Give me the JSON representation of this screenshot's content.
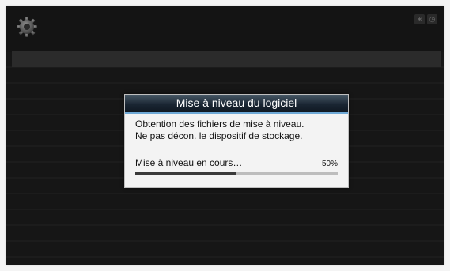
{
  "dialog": {
    "title": "Mise à niveau du logiciel",
    "message_line1": "Obtention des fichiers de mise à niveau.",
    "message_line2": "Ne pas décon. le dispositif de stockage.",
    "progress_label": "Mise à niveau en cours…",
    "progress_percent": "50%",
    "progress_value": 0.5
  },
  "status_icons": [
    "bluetooth-icon",
    "clock-icon"
  ],
  "colors": {
    "screen_bg": "#141414",
    "title_accent": "#6fa9d6",
    "progress_fill": "#3a3a3a"
  }
}
